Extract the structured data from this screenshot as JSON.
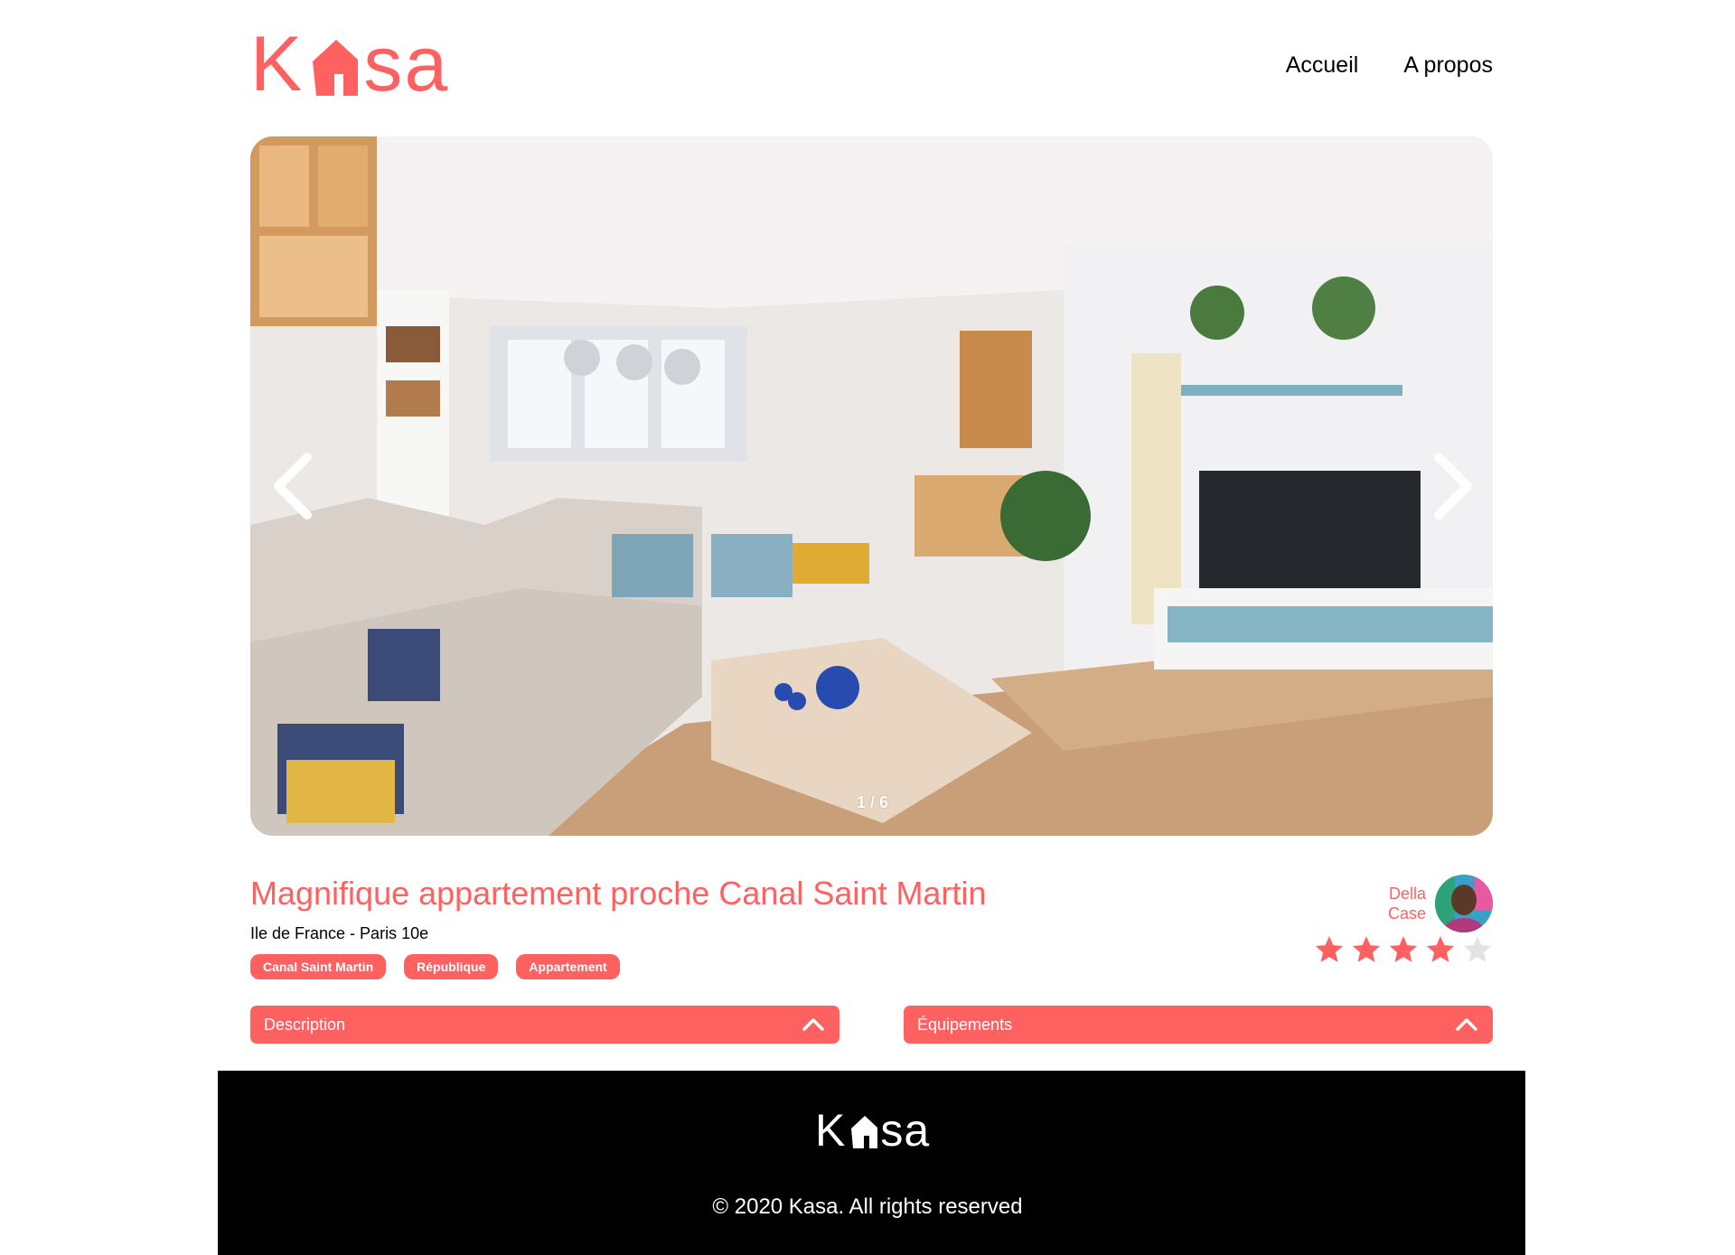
{
  "header": {
    "logo_left": "K",
    "logo_right": "sa",
    "nav": {
      "home": "Accueil",
      "about": "A propos"
    }
  },
  "gallery": {
    "counter": "1 / 6"
  },
  "listing": {
    "title": "Magnifique appartement proche Canal Saint Martin",
    "location": "Ile de France - Paris 10e",
    "tags": [
      "Canal Saint Martin",
      "République",
      "Appartement"
    ],
    "host": {
      "first_name": "Della",
      "last_name": "Case"
    },
    "rating": 4,
    "rating_max": 5
  },
  "collapses": {
    "description_label": "Description",
    "equipments_label": "Équipements"
  },
  "footer": {
    "logo_left": "K",
    "logo_right": "sa",
    "copyright": "© 2020 Kasa. All rights reserved"
  },
  "colors": {
    "accent": "#FF6060",
    "footer_bg": "#000000",
    "star_empty": "#E3E3E3"
  }
}
